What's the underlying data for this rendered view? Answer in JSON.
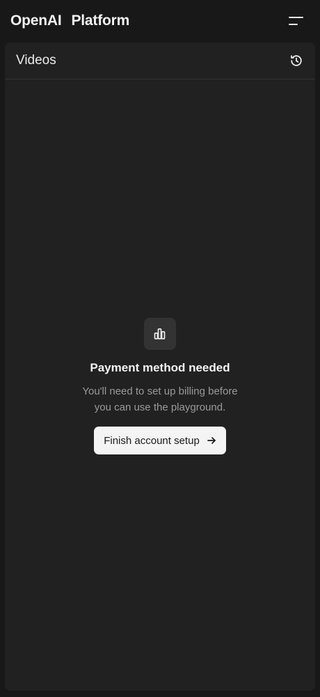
{
  "header": {
    "brand_primary": "OpenAI",
    "brand_secondary": "Platform",
    "menu_icon": "menu-icon"
  },
  "panel": {
    "title": "Videos",
    "history_icon": "history-icon"
  },
  "empty_state": {
    "icon": "bar-chart-icon",
    "title": "Payment method needed",
    "description": "You'll need to set up billing before you can use the playground.",
    "cta_label": "Finish account setup",
    "cta_icon": "arrow-right-icon"
  },
  "colors": {
    "background": "#181818",
    "panel": "#212121",
    "button_bg": "#f4f4f4",
    "muted_text": "#9a9a9a"
  }
}
